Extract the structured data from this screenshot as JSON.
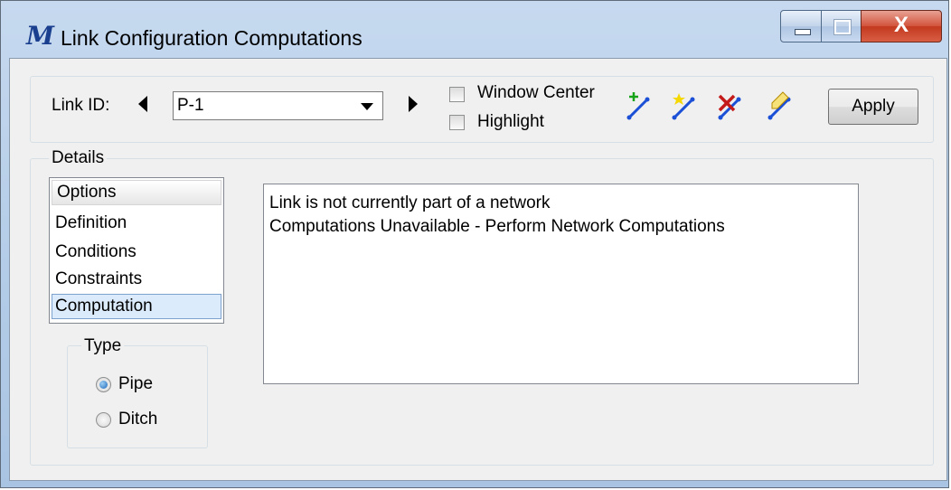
{
  "window": {
    "title": "Link Configuration Computations",
    "close_glyph": "X"
  },
  "toolbar": {
    "link_id_label": "Link ID:",
    "link_id_value": "P-1",
    "window_center_label": "Window Center",
    "highlight_label": "Highlight",
    "apply_label": "Apply",
    "tool_icons": [
      "add-link-icon",
      "select-link-icon",
      "delete-link-icon",
      "edit-link-icon"
    ]
  },
  "details": {
    "caption": "Details",
    "options_header": "Options",
    "options": [
      "Definition",
      "Conditions",
      "Constraints",
      "Computation"
    ],
    "selected_option": "Computation",
    "type": {
      "caption": "Type",
      "options": [
        "Pipe",
        "Ditch"
      ],
      "selected": "Pipe"
    },
    "messages": [
      "Link is not currently part of a network",
      "Computations Unavailable - Perform Network Computations"
    ]
  },
  "colors": {
    "frame": "#b2cbe7",
    "client": "#f0f0f0",
    "close_button": "#c2391f",
    "selection": "#dcebfc"
  }
}
